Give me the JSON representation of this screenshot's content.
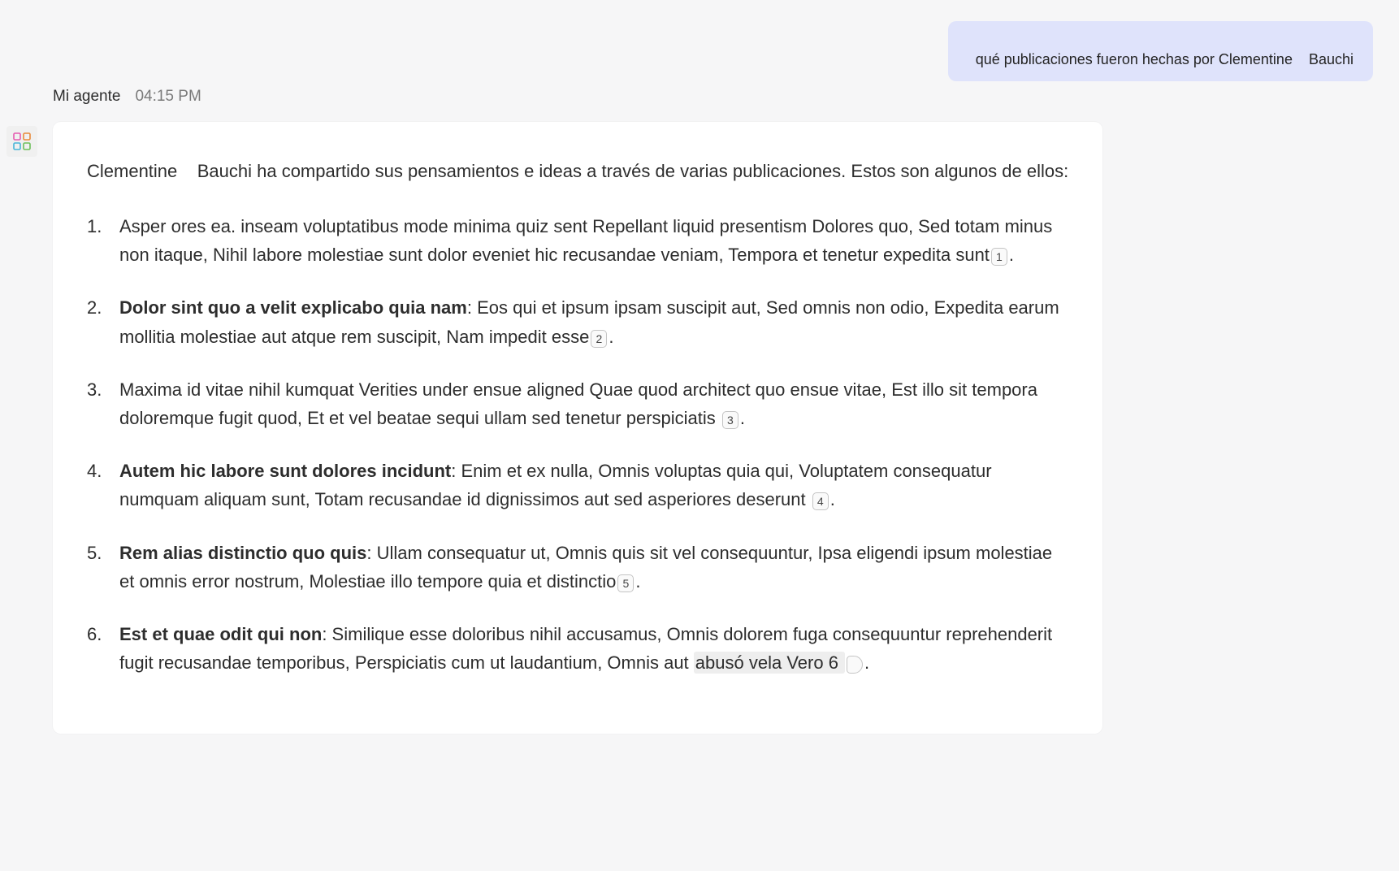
{
  "user_prompt": "qué publicaciones fueron hechas por Clementine    Bauchi",
  "agent": {
    "name": "Mi agente",
    "time": "04:15 PM"
  },
  "response": {
    "intro": "Clementine    Bauchi ha compartido sus pensamientos e ideas a través de varias publicaciones. Estos son algunos de ellos:",
    "items": [
      {
        "title": "Asper ores ea. inseam voluptatibus mode minima quiz sent Repellant liquid presentism Dolores quo,",
        "body_before": " Sed totam minus non itaque, Nihil labore molestiae sunt dolor eveniet hic recusandae veniam, Tempora et tenetur expedita sunt",
        "citation": "1",
        "body_after": "."
      },
      {
        "title": "Dolor sint quo a velit explicabo quia nam",
        "body_before": ": Eos qui et ipsum ipsam suscipit aut, Sed omnis non odio, Expedita earum mollitia molestiae aut atque rem suscipit, Nam impedit esse",
        "citation": "2",
        "body_after": "."
      },
      {
        "title": "Maxima id vitae nihil kumquat Verities under ensue aligned Quae quod architect quo ensue",
        "body_before": " vitae, Est illo sit tempora doloremque fugit quod, Et et vel beatae sequi ullam sed tenetur perspiciatis ",
        "citation": "3",
        "body_after": "."
      },
      {
        "title": "Autem hic labore sunt dolores incidunt",
        "body_before": ": Enim et ex nulla, Omnis voluptas quia qui, Voluptatem consequatur numquam aliquam sunt, Totam recusandae id dignissimos aut sed asperiores deserunt ",
        "citation": "4",
        "body_after": "."
      },
      {
        "title": "Rem alias distinctio quo quis",
        "body_before": ": Ullam consequatur ut, Omnis quis sit vel consequuntur, Ipsa eligendi ipsum molestiae et omnis error nostrum, Molestiae illo tempore quia et distinctio",
        "citation": "5",
        "body_after": "."
      },
      {
        "title": "Est et quae odit qui non",
        "body_before": ": Similique esse doloribus nihil accusamus, Omnis dolorem fuga consequuntur reprehenderit fugit recusandae temporibus, Perspiciatis cum ut laudantium, Omnis aut ",
        "highlight": "abusó vela Vero 6     ",
        "body_after": "."
      }
    ]
  }
}
